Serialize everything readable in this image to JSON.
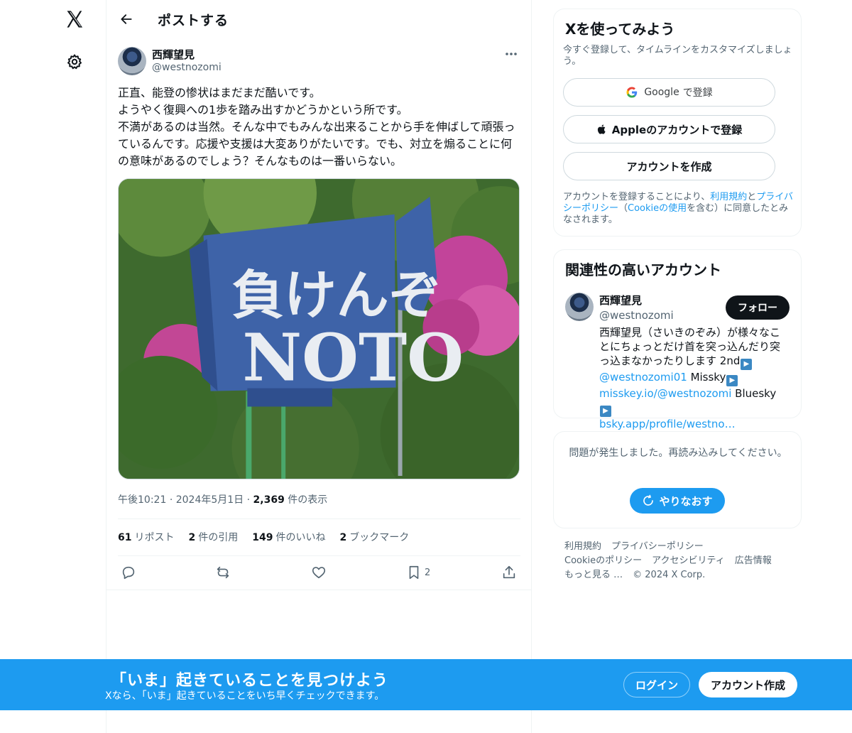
{
  "header": {
    "title": "ポストする"
  },
  "post": {
    "author_name": "西輝望見",
    "author_handle": "@westnozomi",
    "text": "正直、能登の惨状はまだまだ酷いです。\nようやく復興への1歩を踏み出すかどうかという所です。\n不満があるのは当然。そんな中でもみんな出来ることから手を伸ばして頑張っているんです。応援や支援は大変ありがたいです。でも、対立を煽ることに何の意味があるのでしょう？そんなものは一番いらない。",
    "media_text_line1": "負けんぞ",
    "media_text_line2": "NOTO",
    "time": "午後10:21",
    "date": "2024年5月1日",
    "views_count": "2,369",
    "views_label": "件の表示",
    "reposts_count": "61",
    "reposts_label": "リポスト",
    "quotes_count": "2",
    "quotes_label": "件の引用",
    "likes_count": "149",
    "likes_label": "件のいいね",
    "bookmarks_count": "2",
    "bookmarks_label": "ブックマーク",
    "bookmark_action_count": "2"
  },
  "signup_card": {
    "title": "Xを使ってみよう",
    "subtitle": "今すぐ登録して、タイムラインをカスタマイズしましょう。",
    "google_brand": "Google",
    "google_suffix": "で登録",
    "apple_label": "Appleのアカウントで登録",
    "create_label": "アカウントを作成",
    "legal_prefix": "アカウントを登録することにより、",
    "terms_link": "利用規約",
    "legal_and": "と",
    "privacy_link": "プライバシーポリシー",
    "legal_paren_open": "（",
    "cookie_link": "Cookieの使用",
    "legal_suffix": "を含む）に同意したとみなされます。"
  },
  "related_card": {
    "title": "関連性の高いアカウント",
    "name": "西輝望見",
    "handle": "@westnozomi",
    "follow_label": "フォロー",
    "bio_text1": "西輝望見（さいきのぞみ）が様々なことにちょっとだけ首を突っ込んだり突っ込まなかったりします 2nd",
    "bio_link1": "@westnozomi01",
    "bio_text2": " Missky",
    "bio_link2": "misskey.io/@westnozomi",
    "bio_text3": " Bluesky",
    "bio_link3": "bsky.app/profile/westno…"
  },
  "error_card": {
    "message": "問題が発生しました。再読み込みしてください。",
    "retry_label": "やりなおす"
  },
  "footer": {
    "terms": "利用規約",
    "privacy": "プライバシーポリシー",
    "cookie": "Cookieのポリシー",
    "accessibility": "アクセシビリティ",
    "ads": "広告情報",
    "more": "もっと見る …",
    "copyright": "© 2024 X Corp."
  },
  "banner": {
    "title": "「いま」起きていることを見つけよう",
    "subtitle": "Xなら、「いま」起きていることをいち早くチェックできます。",
    "login_label": "ログイン",
    "signup_label": "アカウント作成"
  },
  "colors": {
    "accent": "#1d9bf0",
    "text": "#0f1419",
    "muted": "#536471",
    "border": "#eff3f4"
  },
  "icons": {
    "logo": "x-logo-icon",
    "settings": "gear-icon",
    "back": "arrow-left-icon",
    "more": "more-dots-icon",
    "reply": "reply-icon",
    "repost": "repost-icon",
    "like": "heart-icon",
    "bookmark": "bookmark-icon",
    "share": "share-icon",
    "refresh": "refresh-icon",
    "apple": "apple-icon",
    "google": "google-icon"
  }
}
